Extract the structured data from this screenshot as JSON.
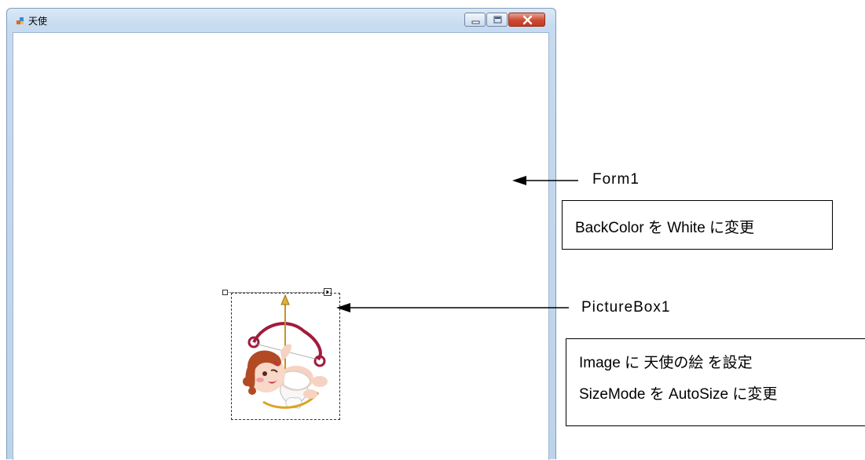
{
  "window": {
    "title": "天使",
    "icon": "form-app-icon",
    "controls": {
      "minimize_icon": "minimize-icon",
      "maximize_icon": "maximize-icon",
      "close_icon": "close-icon"
    }
  },
  "form": {
    "picturebox": {
      "image": "cupid-angel-illustration"
    }
  },
  "annotations": {
    "form_label": "Form1",
    "form_note": "BackColor を White に変更",
    "picturebox_label": "PictureBox1",
    "picturebox_note_line1": "Image に 天使の絵 を設定",
    "picturebox_note_line2": "SizeMode を AutoSize に変更"
  },
  "colors": {
    "form_backcolor": "#ffffff",
    "titlebar": "#c6daf0",
    "close_button": "#cf4a31"
  }
}
